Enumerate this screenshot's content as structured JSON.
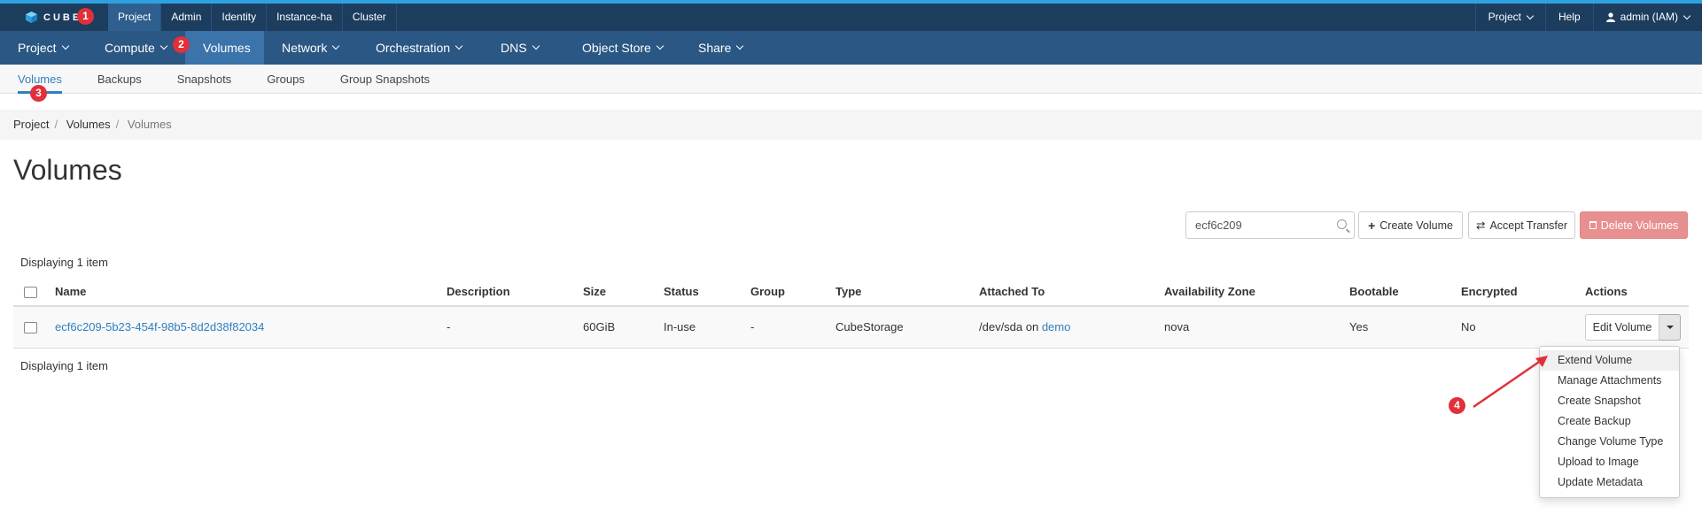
{
  "brand": {
    "name": "CUBE"
  },
  "topnav": {
    "items": [
      "Project",
      "Admin",
      "Identity",
      "Instance-ha",
      "Cluster"
    ],
    "active": "Project"
  },
  "topright": {
    "project": "Project",
    "help": "Help",
    "user": "admin (IAM)"
  },
  "mainnav": {
    "items": [
      "Project",
      "Compute",
      "Volumes",
      "Network",
      "Orchestration",
      "DNS",
      "Object Store",
      "Share"
    ],
    "active": "Volumes"
  },
  "subnav": {
    "tabs": [
      "Volumes",
      "Backups",
      "Snapshots",
      "Groups",
      "Group Snapshots"
    ],
    "active": "Volumes"
  },
  "breadcrumb": [
    "Project",
    "Volumes",
    "Volumes"
  ],
  "page": {
    "title": "Volumes"
  },
  "toolbar": {
    "search_value": "ecf6c209",
    "create_label": "Create Volume",
    "accept_label": "Accept Transfer",
    "delete_label": "Delete Volumes"
  },
  "table": {
    "display_count": "Displaying 1 item",
    "columns": [
      "Name",
      "Description",
      "Size",
      "Status",
      "Group",
      "Type",
      "Attached To",
      "Availability Zone",
      "Bootable",
      "Encrypted",
      "Actions"
    ],
    "rows": [
      {
        "name": "ecf6c209-5b23-454f-98b5-8d2d38f82034",
        "description": "-",
        "size": "60GiB",
        "status": "In-use",
        "group": "-",
        "type": "CubeStorage",
        "attached_prefix": "/dev/sda on ",
        "attached_link": "demo",
        "zone": "nova",
        "bootable": "Yes",
        "encrypted": "No",
        "action": "Edit Volume"
      }
    ]
  },
  "dropdown": {
    "items": [
      "Extend Volume",
      "Manage Attachments",
      "Create Snapshot",
      "Create Backup",
      "Change Volume Type",
      "Upload to Image",
      "Update Metadata"
    ]
  },
  "annotations": [
    "1",
    "2",
    "3",
    "4"
  ],
  "colors": {
    "topbar": "#1c3d5e",
    "mainnav": "#2a5784",
    "active_nav": "#3b73ab",
    "link": "#2f7fc0",
    "danger": "#e8908f",
    "annotation": "#e0303a"
  }
}
